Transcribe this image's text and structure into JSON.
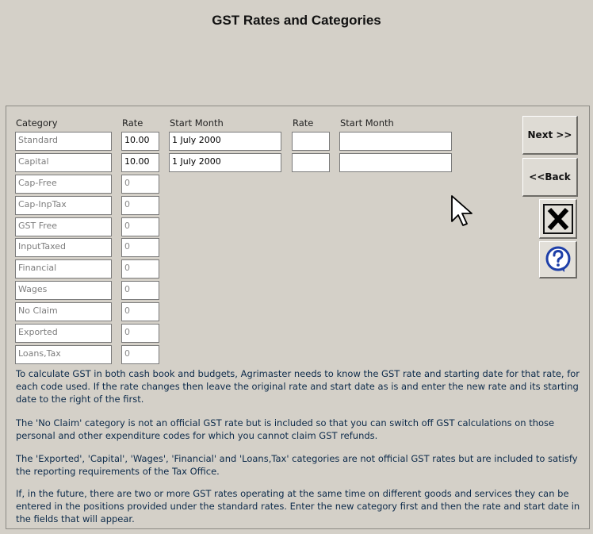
{
  "window": {
    "title": "GST Rates and Categories"
  },
  "columns": {
    "category": "Category",
    "rate": "Rate",
    "start_month": "Start Month",
    "rate2": "Rate",
    "start_month2": "Start Month"
  },
  "rows": [
    {
      "category": "Standard",
      "rate": "10.00",
      "start": "1 July 2000",
      "rate2": "",
      "start2": ""
    },
    {
      "category": "Capital",
      "rate": "10.00",
      "start": "1 July 2000",
      "rate2": "",
      "start2": ""
    },
    {
      "category": "Cap-Free",
      "rate": "0"
    },
    {
      "category": "Cap-InpTax",
      "rate": "0"
    },
    {
      "category": "GST Free",
      "rate": "0"
    },
    {
      "category": "InputTaxed",
      "rate": "0"
    },
    {
      "category": "Financial",
      "rate": "0"
    },
    {
      "category": "Wages",
      "rate": "0"
    },
    {
      "category": "No Claim",
      "rate": "0"
    },
    {
      "category": "Exported",
      "rate": "0"
    },
    {
      "category": "Loans,Tax",
      "rate": "0"
    }
  ],
  "buttons": {
    "next": "Next >>",
    "back": "<<Back",
    "close_icon": "close-x-icon",
    "help_icon": "question-mark-icon"
  },
  "info": {
    "p1": "To calculate GST in both cash book and budgets, Agrimaster needs to know the GST rate and starting date for that rate, for each code used. If the rate changes then leave the original rate and start date as is and enter the new rate and its starting date to the right of the first.",
    "p2": "The 'No Claim' category is not an official GST rate but is included so that you can switch off GST calculations on those personal and other expenditure codes for which you cannot claim GST refunds.",
    "p3": "The 'Exported', 'Capital', 'Wages', 'Financial' and 'Loans,Tax' categories are not official GST rates but are included  to satisfy the reporting requirements of the Tax Office.",
    "p4": "If, in the future, there are two or more GST rates operating at the same time on different goods and services they can be entered in the positions provided under the standard rates. Enter the new category first and then the rate and start date in the fields that will appear."
  },
  "colors": {
    "background": "#d4d0c8",
    "text": "#0c2a4a",
    "help_blue": "#1e3fa8"
  }
}
